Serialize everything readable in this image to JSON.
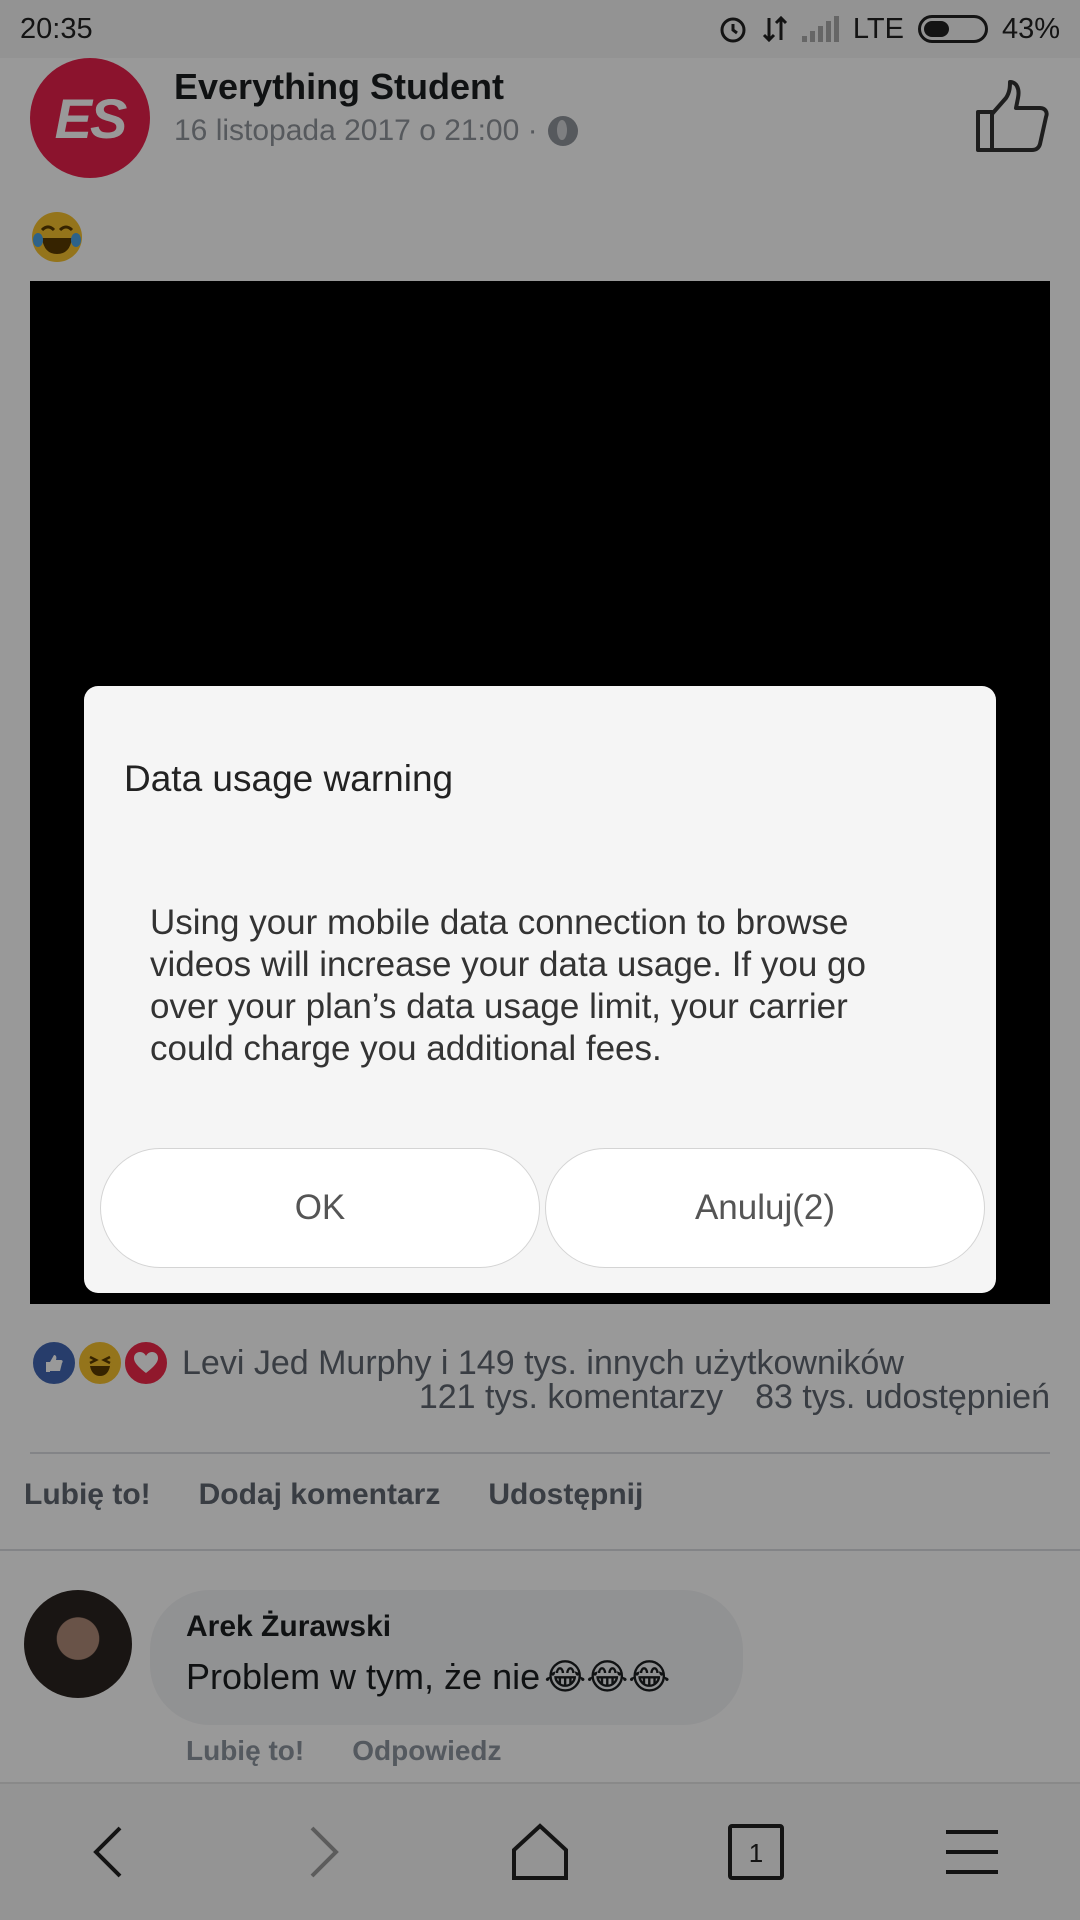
{
  "status_bar": {
    "time": "20:35",
    "network": "LTE",
    "battery": "43%",
    "battery_level": 0.43
  },
  "post": {
    "avatar_text": "ES",
    "page_name": "Everything Student",
    "date": "16 listopada 2017 o 21:00 ·",
    "emoji": "😂"
  },
  "reactions": {
    "summary": "Levi Jed Murphy i 149 tys. innych użytkowników",
    "comments": "121 tys. komentarzy",
    "shares": "83 tys. udostępnień"
  },
  "actions": {
    "like": "Lubię to!",
    "comment": "Dodaj komentarz",
    "share": "Udostępnij"
  },
  "comment": {
    "author": "Arek Żurawski",
    "text": "Problem w tym, że nie",
    "emojis": "😂😂😂",
    "like": "Lubię to!",
    "reply": "Odpowiedz"
  },
  "navigation": {
    "tab_count": "1"
  },
  "dialog": {
    "title": "Data usage warning",
    "message": "Using your mobile data connection to browse videos will increase your data usage. If you go over your plan’s data usage limit,     your carrier could charge you additional fees.",
    "ok_label": "OK",
    "cancel_label": "Anuluj(2)"
  },
  "colors": {
    "brand_red": "#e8214b",
    "facebook_blue": "#4267b2"
  }
}
